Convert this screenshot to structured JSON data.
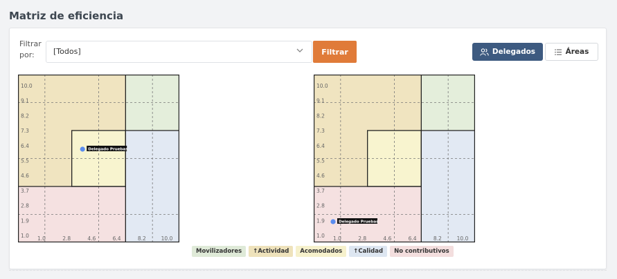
{
  "page": {
    "title": "Matriz de eficiencia"
  },
  "filter": {
    "label": "Filtrar por:",
    "selected": "[Todos]",
    "button": "Filtrar"
  },
  "view_toggle": {
    "delegados": "Delegados",
    "areas": "Áreas",
    "active": "delegados"
  },
  "chart_data": [
    {
      "type": "scatter",
      "y_ticks": [
        "10.0",
        "9.1",
        "8.2",
        "7.3",
        "6.4",
        "5.5",
        "4.6",
        "3.7",
        "2.8",
        "1.9",
        "1.0"
      ],
      "x_ticks": [
        "1.0",
        "2.8",
        "4.6",
        "6.4",
        "8.2",
        "10.0"
      ],
      "xlim": [
        1,
        10
      ],
      "ylim": [
        1,
        10
      ],
      "grid": true,
      "points": [
        {
          "label": "Delegado Pruebas",
          "x": 4.6,
          "y": 6.0
        }
      ]
    },
    {
      "type": "scatter",
      "y_ticks": [
        "10.0",
        "9.1",
        "8.2",
        "7.3",
        "6.4",
        "5.5",
        "4.6",
        "3.7",
        "2.8",
        "1.9",
        "1.0"
      ],
      "x_ticks": [
        "1.0",
        "2.8",
        "4.6",
        "6.4",
        "8.2",
        "10.0"
      ],
      "xlim": [
        1,
        10
      ],
      "ylim": [
        1,
        10
      ],
      "grid": true,
      "points": [
        {
          "label": "Delegado Pruebas",
          "x": 2.0,
          "y": 1.0
        }
      ]
    }
  ],
  "legend": [
    {
      "label": "Movilizadores",
      "color": "#dfead8"
    },
    {
      "label": "↑Actividad",
      "color": "#eee2bb"
    },
    {
      "label": "Acomodados",
      "color": "#f6f1cc"
    },
    {
      "label": "↑Calidad",
      "color": "#dde6f1"
    },
    {
      "label": "No contributivos",
      "color": "#f3dede"
    }
  ],
  "zone_colors": {
    "actividad": "#f0e4c0",
    "movilizadores": "#e4eedb",
    "calidad": "#e2e9f3",
    "no_contributivos": "#f5e1e1",
    "acomodados": "#f8f4cf",
    "point": "#5b8def"
  }
}
